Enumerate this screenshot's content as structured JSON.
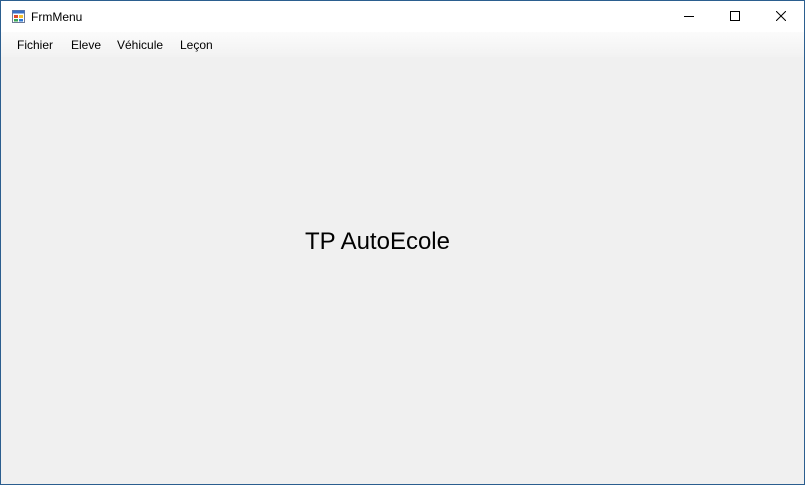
{
  "window": {
    "title": "FrmMenu",
    "icon": "winforms-app-icon",
    "controls": {
      "minimize_icon": "minimize-icon",
      "maximize_icon": "maximize-icon",
      "close_icon": "close-icon"
    }
  },
  "menu": {
    "items": [
      {
        "label": "Fichier"
      },
      {
        "label": "Eleve"
      },
      {
        "label": "Véhicule"
      },
      {
        "label": "Leçon"
      }
    ]
  },
  "main": {
    "label": "TP AutoEcole"
  },
  "colors": {
    "border": "#2b5e8f",
    "background": "#f0f0f0",
    "titlebar": "#ffffff"
  }
}
